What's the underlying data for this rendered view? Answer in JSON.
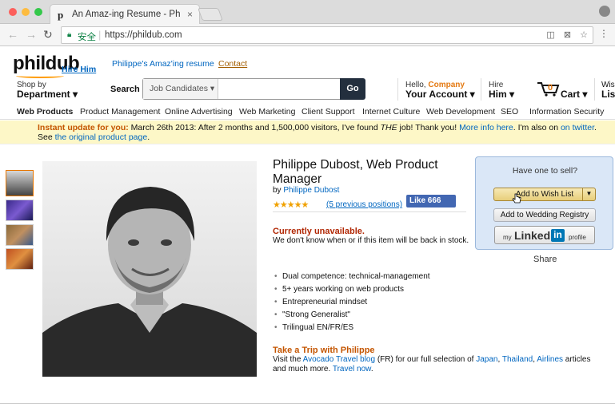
{
  "browser": {
    "tab_title": "An Amaz-ing Resume - Philipp",
    "tab_favicon": "p",
    "tab_close": "×",
    "secure_label": "安全",
    "url": "https://phildub.com"
  },
  "header": {
    "logo": "phildub",
    "logo_tagline": "Hire Him",
    "link1": "Philippe's Amaz'ing resume",
    "link2": "Contact",
    "shop_small": "Shop by",
    "shop_big": "Department ▾",
    "search_label": "Search",
    "search_category": "Job Candidates ▾",
    "search_value": "",
    "search_button": "Go",
    "account_small_prefix": "Hello, ",
    "account_small_name": "Company",
    "account_big": "Your Account ▾",
    "hire_small": "Hire",
    "hire_big": "Him ▾",
    "cart_count": "0",
    "cart_label": "Cart ▾",
    "wish_small": "Wis",
    "wish_big": "Lis"
  },
  "subnav": [
    "Web Products",
    "Product Management",
    "Online Advertising",
    "Web Marketing",
    "Client Support",
    "Internet Culture",
    "Web Development",
    "SEO",
    "Information Security"
  ],
  "banner": {
    "highlight": "Instant update for you:",
    "text1": " March 26th 2013: After 2 months and 1,500,000 visitors, I've found ",
    "the": "THE",
    "text2": " job! Thank you! ",
    "more_link": "More info here",
    "text3": ". I'm also on ",
    "twitter_link": "on twitter",
    "text4": ".",
    "see": "See ",
    "original_link": "the original product page",
    "end": "."
  },
  "product": {
    "title": "Philippe Dubost, Web Product Manager",
    "by": "by ",
    "author": "Philippe Dubost",
    "stars": "★★★★★",
    "reviews": "(5 previous positions)",
    "fb_like": "Like 666",
    "unavailable": "Currently unavailable.",
    "unavailable_msg": "We don't know when or if this item will be back in stock.",
    "bullets": [
      "Dual competence: technical-management",
      "5+ years working on web products",
      "Entrepreneurial mindset",
      "\"Strong Generalist\"",
      "Trilingual EN/FR/ES"
    ],
    "trip_title": "Take a Trip with Philippe",
    "trip_pre": "Visit the ",
    "trip_blog": "Avocado Travel blog",
    "trip_mid": " (FR) for our full selection of ",
    "trip_japan": "Japan",
    "trip_comma": ", ",
    "trip_thailand": "Thailand",
    "trip_comma2": ", ",
    "trip_airlines": "Airlines",
    "trip_post": " articles and much more. ",
    "trip_travel_now": "Travel now",
    "trip_end": "."
  },
  "buybox": {
    "title": "Have one to sell?",
    "wish_list": "Add to Wish List",
    "wedding": "Add to Wedding Registry",
    "linkedin_my": "my",
    "linkedin_name": "Linked",
    "linkedin_in": "in",
    "linkedin_profile": "profile",
    "share": "Share"
  },
  "colors": {
    "accent_orange": "#e47911",
    "link_blue": "#0066c0",
    "banner_bg": "#fdf7c7",
    "buybox_bg": "#dae7f7"
  }
}
